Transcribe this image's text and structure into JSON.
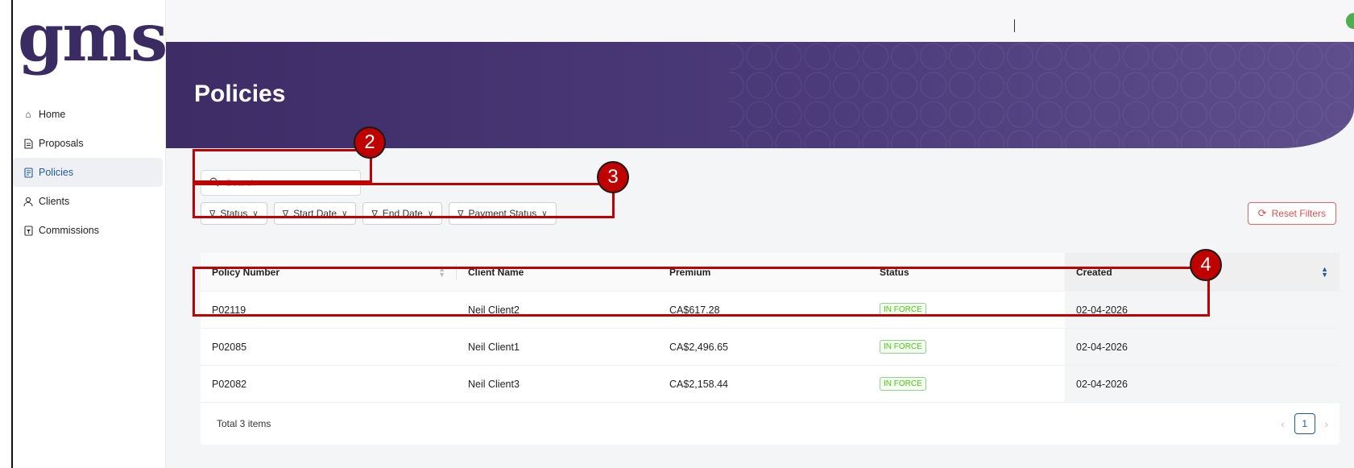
{
  "app": {
    "logo_text": "gms"
  },
  "sidebar": {
    "items": [
      {
        "label": "Home",
        "icon": "home-icon"
      },
      {
        "label": "Proposals",
        "icon": "document-icon"
      },
      {
        "label": "Policies",
        "icon": "policy-icon",
        "active": true
      },
      {
        "label": "Clients",
        "icon": "user-icon"
      },
      {
        "label": "Commissions",
        "icon": "commission-icon"
      }
    ]
  },
  "header": {
    "title": "Policies"
  },
  "toolbar": {
    "search_placeholder": "Search",
    "filters": [
      "Status",
      "Start Date",
      "End Date",
      "Payment Status"
    ],
    "reset_label": "Reset Filters"
  },
  "table": {
    "columns": [
      "Policy Number",
      "Client Name",
      "Premium",
      "Status",
      "Created"
    ],
    "rows": [
      {
        "policy": "P02119",
        "client": "Neil Client2",
        "premium": "CA$617.28",
        "status": "IN FORCE",
        "created": "02-04-2026"
      },
      {
        "policy": "P02085",
        "client": "Neil Client1",
        "premium": "CA$2,496.65",
        "status": "IN FORCE",
        "created": "02-04-2026"
      },
      {
        "policy": "P02082",
        "client": "Neil Client3",
        "premium": "CA$2,158.44",
        "status": "IN FORCE",
        "created": "02-04-2026"
      }
    ],
    "total_label": "Total 3 items",
    "current_page": "1"
  },
  "annotations": [
    "2",
    "3",
    "4"
  ],
  "colors": {
    "brand": "#3b2b63",
    "accent": "#1f5c99",
    "annotation": "#c00000",
    "status_green": "#52c41a",
    "reset_red": "#d9534f"
  }
}
